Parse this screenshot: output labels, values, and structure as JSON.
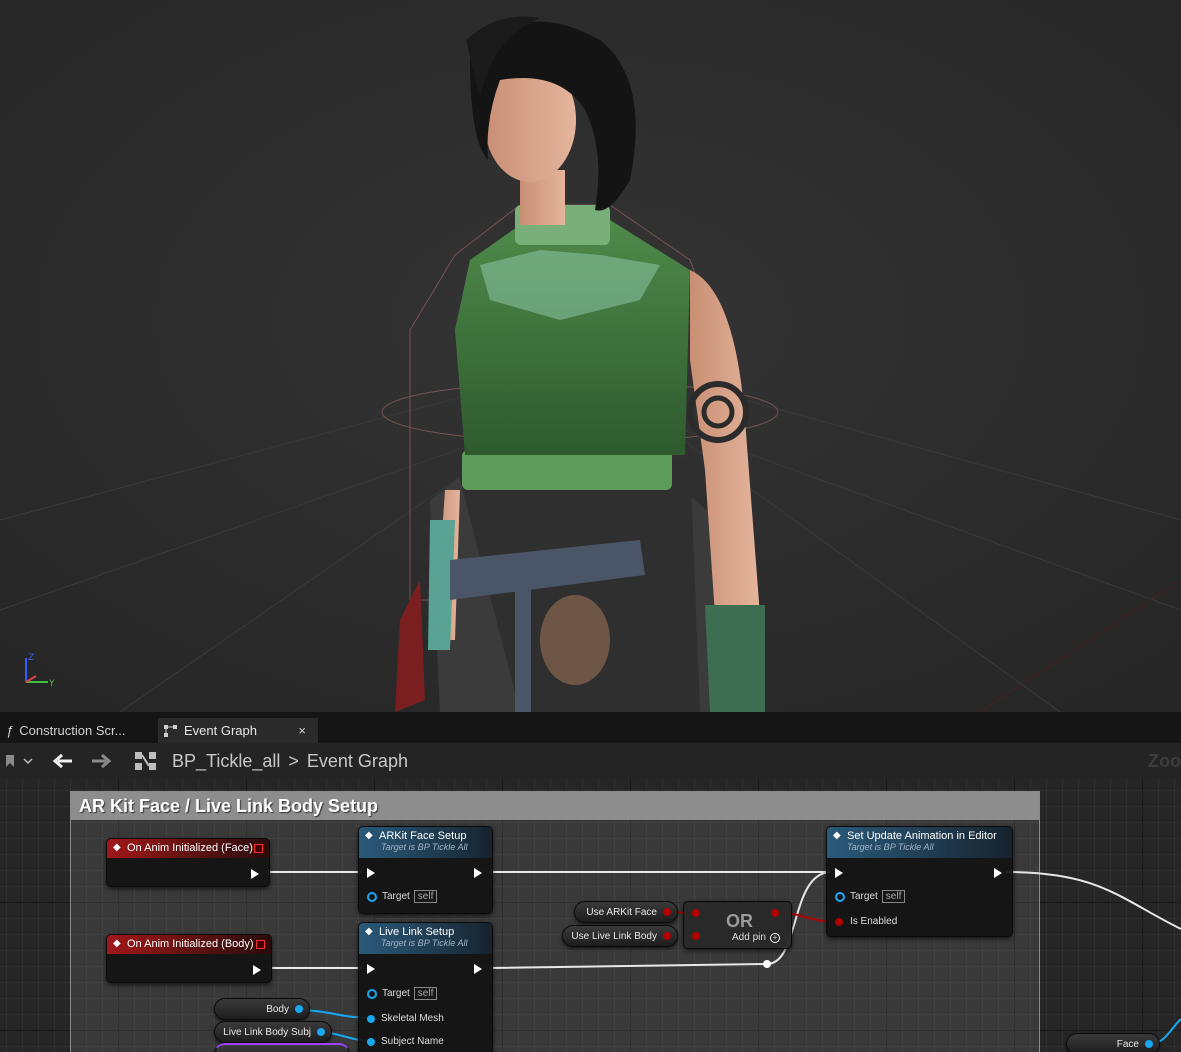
{
  "tabs": [
    {
      "label": "Construction Scr...",
      "icon": "function-icon"
    },
    {
      "label": "Event Graph",
      "icon": "graph-icon",
      "close": "×"
    }
  ],
  "toolbar": {
    "breadcrumb_root": "BP_Tickle_all",
    "breadcrumb_sep": ">",
    "breadcrumb_current": "Event Graph",
    "zoom_label": "Zoo"
  },
  "graph": {
    "comment_title": "AR Kit Face / Live Link Body Setup",
    "nodes": {
      "event_face": {
        "title": "On Anim Initialized (Face)"
      },
      "event_body": {
        "title": "On Anim Initialized (Body)"
      },
      "arkit_setup": {
        "title": "ARKit Face Setup",
        "subtitle": "Target is BP Tickle All",
        "target_label": "Target",
        "target_value": "self"
      },
      "livelink_setup": {
        "title": "Live Link Setup",
        "subtitle": "Target is BP Tickle All",
        "target_label": "Target",
        "target_value": "self",
        "mesh_label": "Skeletal Mesh",
        "subject_label": "Subject Name"
      },
      "set_update": {
        "title": "Set Update Animation in Editor",
        "subtitle": "Target is BP Tickle All",
        "target_label": "Target",
        "target_value": "self",
        "enabled_label": "Is Enabled"
      },
      "or_node": {
        "title": "OR",
        "add_pin": "Add pin"
      }
    },
    "variables": {
      "use_arkit_face": "Use ARKit Face",
      "use_live_link_body": "Use Live Link Body",
      "body": "Body",
      "live_link_body_subj": "Live Link Body Subj",
      "face": "Face"
    }
  },
  "colors": {
    "event_header": "#a01818",
    "function_header": "#2a5a7a",
    "object_pin": "#17a8f0",
    "bool_pin": "#b00000",
    "comment_bar": "#8d8d8d"
  }
}
